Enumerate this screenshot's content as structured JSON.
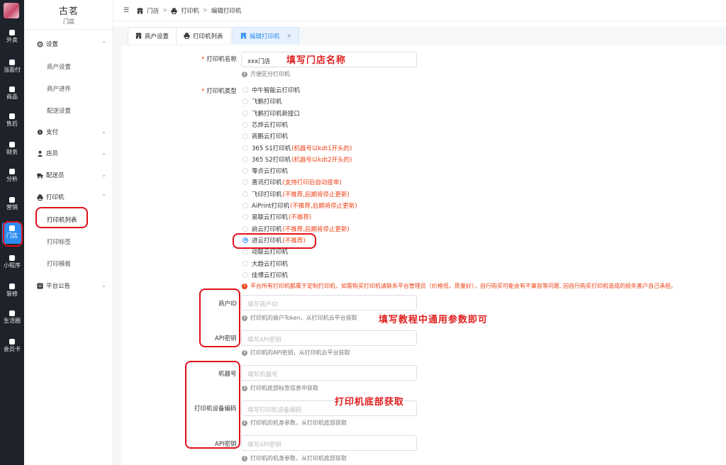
{
  "rail": {
    "items": [
      {
        "label": "外卖",
        "icon": "bag-icon"
      },
      {
        "label": "当面付",
        "icon": "scan-icon"
      },
      {
        "label": "商品",
        "icon": "goods-icon"
      },
      {
        "label": "售后",
        "icon": "headset-icon"
      },
      {
        "label": "财务",
        "icon": "finance-icon"
      },
      {
        "label": "分析",
        "icon": "chart-icon"
      },
      {
        "label": "营销",
        "icon": "gift-icon"
      },
      {
        "label": "门店",
        "icon": "store-icon"
      },
      {
        "label": "小程序",
        "icon": "chat-icon"
      },
      {
        "label": "装修",
        "icon": "shirt-icon"
      },
      {
        "label": "生活圈",
        "icon": "circle-icon"
      },
      {
        "label": "会员卡",
        "icon": "card-icon"
      }
    ]
  },
  "store": {
    "name": "古茗",
    "sub": "门店"
  },
  "menu": {
    "settings": "设置",
    "merchant_settings": "商户设置",
    "merchant_onboard": "商户进件",
    "delivery_settings": "配送设置",
    "payment": "支付",
    "clerk": "店员",
    "courier": "配送员",
    "printer": "打印机",
    "printer_list": "打印机列表",
    "print_label": "打印标签",
    "print_template": "打印模板",
    "notice": "平台公告"
  },
  "breadcrumb": {
    "store": "门店",
    "printer": "打印机",
    "edit": "编辑打印机"
  },
  "tabs": {
    "t1": "商户设置",
    "t2": "打印机列表",
    "t3": "编辑打印机"
  },
  "form": {
    "name_label": "打印机名称",
    "name_value": "xxx门店",
    "name_hint": "方便区分打印机",
    "type_label": "打印机类型",
    "options": [
      {
        "label": "中午智能云打印机",
        "note": ""
      },
      {
        "label": "飞鹅打印机",
        "note": ""
      },
      {
        "label": "飞鹅打印机新接口",
        "note": ""
      },
      {
        "label": "芯烨云打印机",
        "note": ""
      },
      {
        "label": "商鹏云打印机",
        "note": ""
      },
      {
        "label": "365 S1打印机",
        "note": "(机器号以kdt1开头的)"
      },
      {
        "label": "365 S2打印机",
        "note": "(机器号以kdt2开头的)"
      },
      {
        "label": "零点云打印机",
        "note": ""
      },
      {
        "label": "喜讯打印机",
        "note": "(支持打印后自动接单)"
      },
      {
        "label": "飞印打印机",
        "note": "(不推荐,后期将停止更新)"
      },
      {
        "label": "AiPrint打印机",
        "note": "(不推荐,后期将停止更新)"
      },
      {
        "label": "易联云打印机",
        "note": "(不推荐)"
      },
      {
        "label": "启云打印机",
        "note": "(不推荐,后期将停止更新)"
      },
      {
        "label": "进云打印机",
        "note": "(不推荐)"
      },
      {
        "label": "动联云打印机",
        "note": ""
      },
      {
        "label": "大趋云打印机",
        "note": ""
      },
      {
        "label": "佳博云打印机",
        "note": ""
      }
    ],
    "selected_index": 13,
    "warning": "平台所有打印机都属于定制打印机，如需购买打印机请联系平台管理员（价格低，质量好），自行购买可能会有不兼容等问题, 因自行购买打印机造成的损失客户自己承担。",
    "merchant_id_label": "商户ID",
    "merchant_id_placeholder": "填写商户ID",
    "merchant_id_hint": "打印机的商户Token，从打印机云平台获取",
    "api_key_label": "API密钥",
    "api_key_placeholder": "填写API密钥",
    "api_key_hint": "打印机的API密钥，从打印机云平台获取",
    "machine_no_label": "机器号",
    "machine_no_placeholder": "填写机器号",
    "machine_no_hint": "打印机底部标签信息中获取",
    "device_code_label": "打印机设备编码",
    "device_code_placeholder": "填写打印机设备编码",
    "device_code_hint": "打印机的机身参数，从打印机底部获取",
    "api_key2_label": "API密钥",
    "api_key2_placeholder": "填写API密钥",
    "api_key2_hint": "打印机的机身参数，从打印机底部获取"
  },
  "annotations": {
    "a1": "填写门店名称",
    "a2": "填写教程中通用参数即可",
    "a3": "打印机底部获取"
  }
}
